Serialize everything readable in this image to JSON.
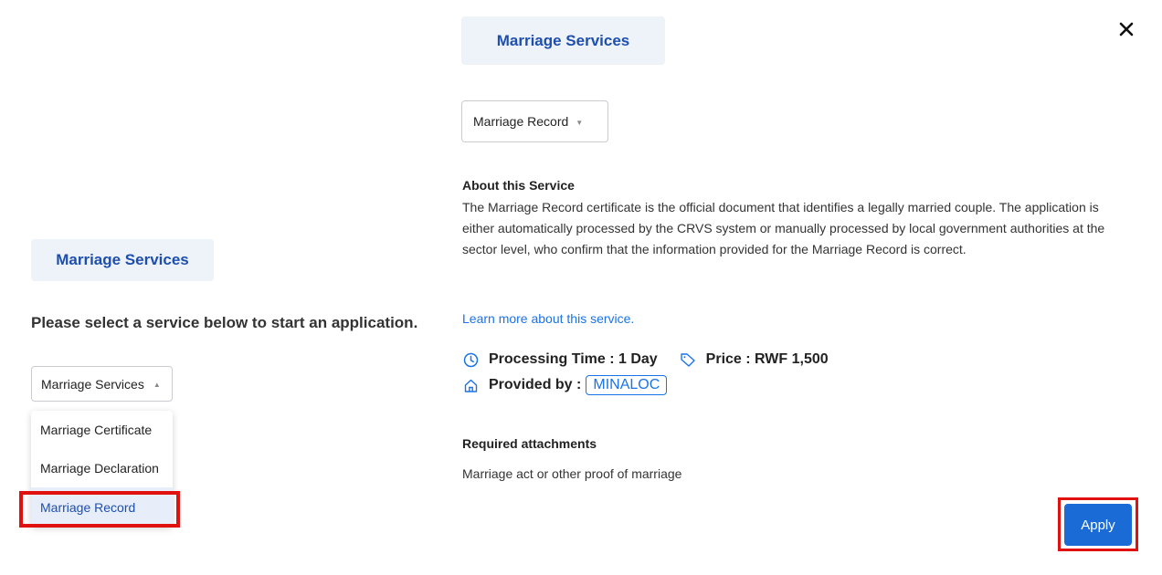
{
  "left_panel": {
    "badge_label": "Marriage Services",
    "prompt": "Please select a service below to start an application.",
    "select_value": "Marriage Services",
    "dropdown_options": [
      "Marriage Certificate",
      "Marriage Declaration",
      "Marriage Record"
    ],
    "selected_option": "Marriage Record"
  },
  "right_panel": {
    "badge_label": "Marriage Services",
    "select_value": "Marriage Record",
    "about_title": "About this Service",
    "about_text": "The Marriage Record certificate is the official document that identifies a legally married couple. The application is either automatically processed by the CRVS system or manually processed by local government authorities at the sector level, who confirm that the information provided for the Marriage Record is correct.",
    "learn_more": "Learn more about this service.",
    "processing_time": "Processing Time : 1 Day",
    "price": "Price : RWF 1,500",
    "provided_by_label": "Provided by :",
    "provider": "MINALOC",
    "required_title": "Required attachments",
    "required_text": "Marriage act or other proof of marriage",
    "apply_label": "Apply"
  },
  "icons": {
    "close": "close-icon",
    "clock": "clock-icon",
    "tag": "tag-icon",
    "home": "home-icon",
    "caret": "caret-icon"
  },
  "colors": {
    "accent": "#1a6bd6",
    "badge_bg": "#eef2f9",
    "badge_text": "#1d4fae",
    "link": "#1a73e8",
    "highlight": "#e0110f"
  }
}
